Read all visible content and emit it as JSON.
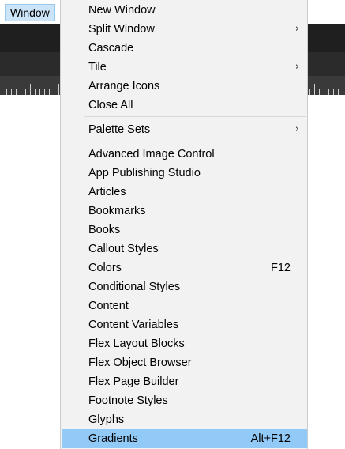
{
  "menubar": {
    "window_label": "Window"
  },
  "menu": {
    "group1": [
      {
        "label": "New Window",
        "shortcut": "",
        "submenu": false
      },
      {
        "label": "Split Window",
        "shortcut": "",
        "submenu": true
      },
      {
        "label": "Cascade",
        "shortcut": "",
        "submenu": false
      },
      {
        "label": "Tile",
        "shortcut": "",
        "submenu": true
      },
      {
        "label": "Arrange Icons",
        "shortcut": "",
        "submenu": false
      },
      {
        "label": "Close All",
        "shortcut": "",
        "submenu": false
      }
    ],
    "group2": [
      {
        "label": "Palette Sets",
        "shortcut": "",
        "submenu": true
      }
    ],
    "group3": [
      {
        "label": "Advanced Image Control",
        "shortcut": ""
      },
      {
        "label": "App Publishing Studio",
        "shortcut": ""
      },
      {
        "label": "Articles",
        "shortcut": ""
      },
      {
        "label": "Bookmarks",
        "shortcut": ""
      },
      {
        "label": "Books",
        "shortcut": ""
      },
      {
        "label": "Callout Styles",
        "shortcut": ""
      },
      {
        "label": "Colors",
        "shortcut": "F12"
      },
      {
        "label": "Conditional Styles",
        "shortcut": ""
      },
      {
        "label": "Content",
        "shortcut": ""
      },
      {
        "label": "Content Variables",
        "shortcut": ""
      },
      {
        "label": "Flex Layout Blocks",
        "shortcut": ""
      },
      {
        "label": "Flex Object Browser",
        "shortcut": ""
      },
      {
        "label": "Flex Page Builder",
        "shortcut": ""
      },
      {
        "label": "Footnote Styles",
        "shortcut": ""
      },
      {
        "label": "Glyphs",
        "shortcut": ""
      },
      {
        "label": "Gradients",
        "shortcut": "Alt+F12",
        "selected": true
      }
    ],
    "chevron_glyph": "›",
    "highlight_color": "#91c9f7"
  }
}
